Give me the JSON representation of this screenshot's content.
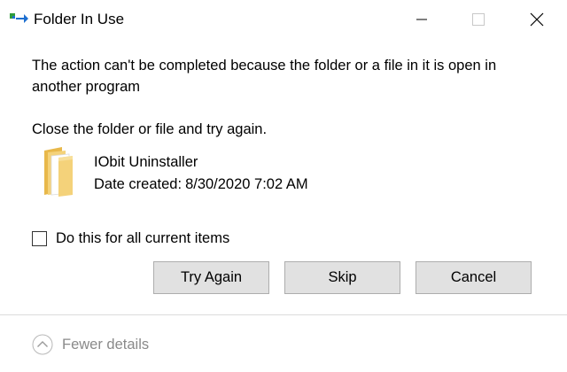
{
  "window": {
    "title": "Folder In Use",
    "title_icon": "folder-move-icon",
    "controls": {
      "minimize_icon": "minimize-icon",
      "maximize_icon": "maximize-icon",
      "close_icon": "close-icon"
    }
  },
  "message": "The action can't be completed because the folder or a file in it is open in another program",
  "instruction": "Close the folder or file and try again.",
  "item": {
    "icon": "folder-icon",
    "name": "IObit Uninstaller",
    "date_label": "Date created:",
    "date_value": "8/30/2020 7:02 AM"
  },
  "checkbox": {
    "label": "Do this for all current items",
    "checked": false
  },
  "buttons": {
    "try_again": "Try Again",
    "skip": "Skip",
    "cancel": "Cancel"
  },
  "footer": {
    "toggle_label": "Fewer details",
    "toggle_icon": "chevron-up-circle-icon"
  },
  "colors": {
    "button_bg": "#e1e1e1",
    "button_border": "#adadad",
    "footer_text": "#8a8a8a",
    "folder_yellow": "#f4d27a"
  }
}
